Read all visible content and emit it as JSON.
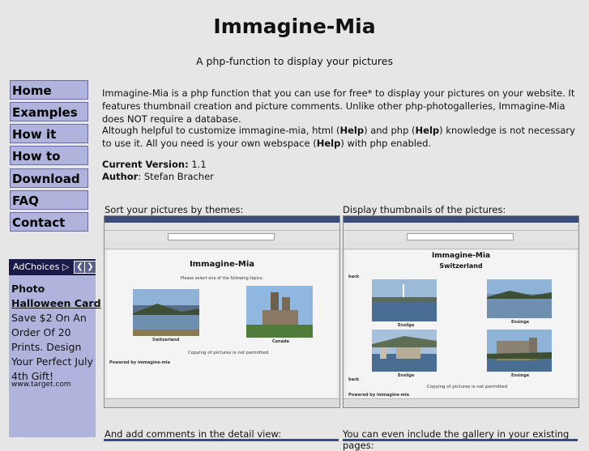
{
  "header": {
    "title": "Immagine-Mia",
    "subtitle": "A php-function to display your pictures"
  },
  "nav": [
    {
      "label": "Home"
    },
    {
      "label": "Examples"
    },
    {
      "label": "How it works"
    },
    {
      "label": "How to use it"
    },
    {
      "label": "Download"
    },
    {
      "label": "FAQ"
    },
    {
      "label": "Contact"
    }
  ],
  "ad": {
    "adchoices": "AdChoices",
    "title": "Photo",
    "title2": "Halloween Card",
    "text": "Save $2 On An Order Of 20 Prints. Design Your Perfect July 4th Gift!",
    "url": "www.target.com"
  },
  "content": {
    "intro": "Immagine-Mia is a php function that you can use for free* to display your pictures on your website. It features thumbnail creation and picture comments. Unlike other php-photogalleries, Immagine-Mia does NOT require a database.",
    "help_p1": "Altough helpful to customize immagine-mia, html (",
    "help_b1": "Help",
    "help_p2": ") and php (",
    "help_b2": "Help",
    "help_p3": ") knowledge is not necessary to use it. All you need is your own webspace (",
    "help_b3": "Help",
    "help_p4": ") with php enabled.",
    "version_label": "Current Version:",
    "version_value": " 1.1",
    "author_label": "Author",
    "author_value": ": Stefan Bracher"
  },
  "captions": {
    "c1": "Sort your pictures by themes:",
    "c2": "Display thumbnails of the pictures:",
    "c3": "And add comments in the detail view:",
    "c4": "You can even include the gallery in your existing pages:"
  },
  "shot1": {
    "title": "Immagine-Mia",
    "instruction": "Please select one of the following topics:",
    "label_a": "Switzerland",
    "label_b": "Canada",
    "copy": "Copying of pictures is not permitted",
    "powered": "Powered by immagine-mia"
  },
  "shot2": {
    "title": "Immagine-Mia",
    "subtitle": "Switzerland",
    "back": "back",
    "back2": "back",
    "label_a": "Ensilge",
    "label_b": "Ensinge",
    "label_c": "Ensilge",
    "label_d": "Ensinge",
    "copy": "Copying of pictures is not permitted",
    "powered": "Powered by immagine-mia"
  },
  "colors": {
    "background": "#e6e6e6",
    "nav_bg": "#b0b4dd",
    "ad_header": "#1b1b4a"
  }
}
